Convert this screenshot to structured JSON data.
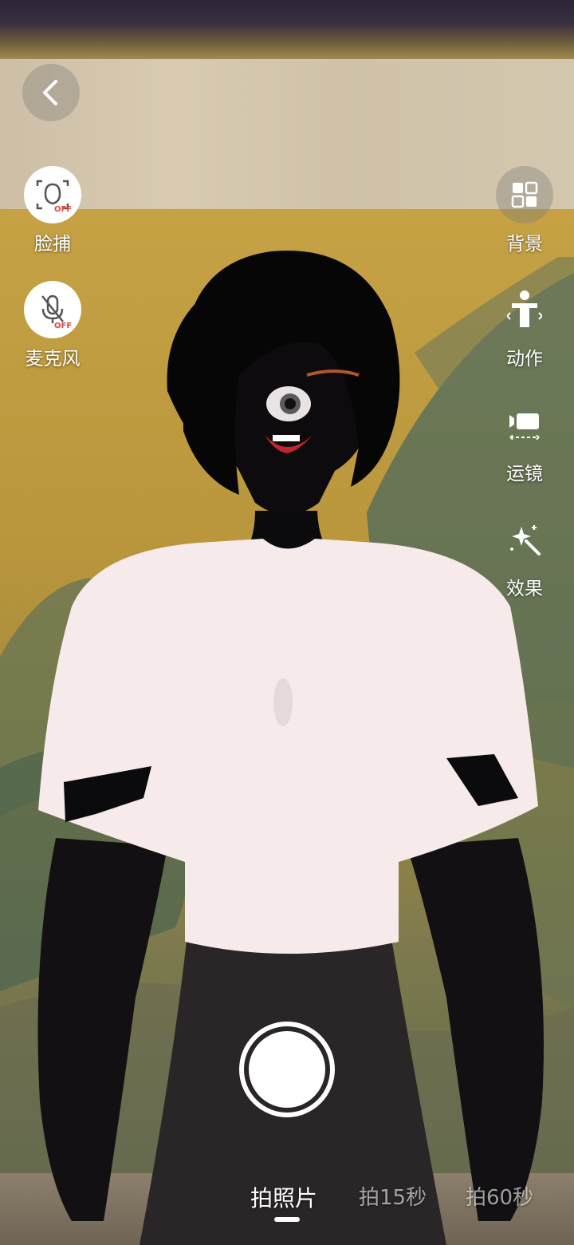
{
  "left_controls": [
    {
      "label": "脸捕",
      "icon": "face-capture-off-icon",
      "badge": "OFF"
    },
    {
      "label": "麦克风",
      "icon": "microphone-off-icon",
      "badge": "OFF"
    }
  ],
  "right_controls": [
    {
      "label": "背景",
      "icon": "background-icon"
    },
    {
      "label": "动作",
      "icon": "action-icon"
    },
    {
      "label": "运镜",
      "icon": "camera-movement-icon"
    },
    {
      "label": "效果",
      "icon": "effects-icon"
    }
  ],
  "modes": [
    {
      "label": "拍照片",
      "active": true
    },
    {
      "label": "拍15秒",
      "active": false
    },
    {
      "label": "拍60秒",
      "active": false
    }
  ],
  "colors": {
    "badge": "#e8433b",
    "icon": "#555555",
    "active_mode": "#ffffff"
  }
}
